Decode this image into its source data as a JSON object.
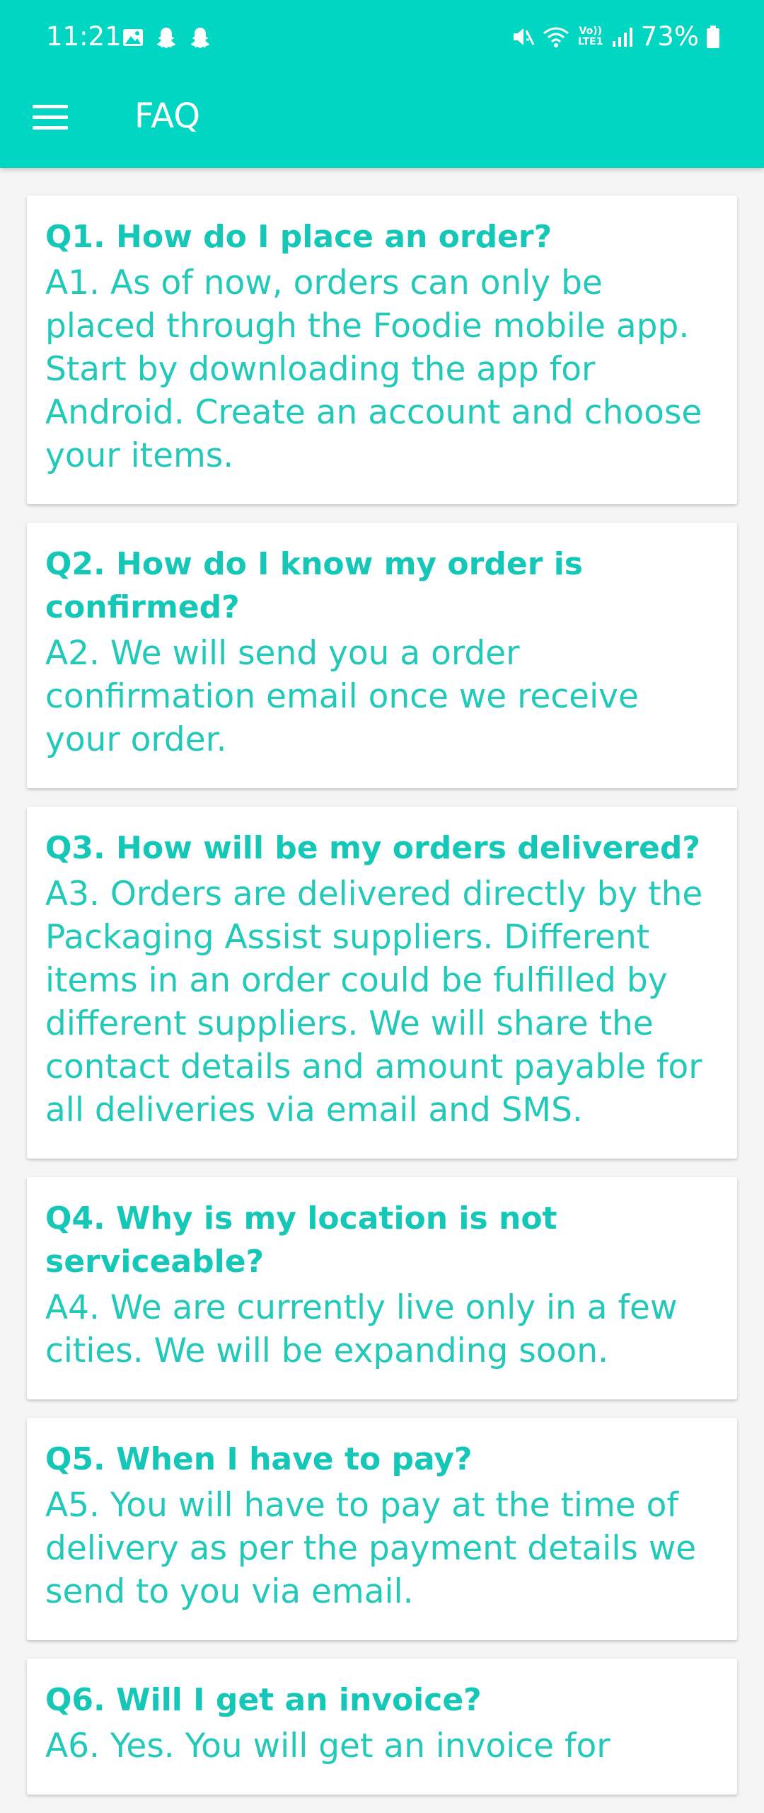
{
  "status_bar": {
    "time": "11:21",
    "battery": "73%",
    "left_icons": [
      "image-icon",
      "snapchat-icon",
      "snapchat-icon"
    ],
    "right_icons": [
      "mute-icon",
      "wifi-icon",
      "volte-icon",
      "signal-icon",
      "battery-icon"
    ],
    "volte_label": "Vo)) LTE1"
  },
  "toolbar": {
    "title": "FAQ",
    "menu_icon": "hamburger-menu-icon"
  },
  "colors": {
    "primary": "#00d6c1",
    "text_accent": "#14c7b6",
    "background": "#f5f5f5"
  },
  "faqs": [
    {
      "question": "Q1. How do I place an order?",
      "answer": "A1. As of now, orders can only be placed through the Foodie mobile app. Start by downloading the app for Android. Create an account and choose your items."
    },
    {
      "question": "Q2. How do I know my order is confirmed?",
      "answer": "A2. We will send you a order confirmation email once we receive your order."
    },
    {
      "question": "Q3. How will be my orders delivered?",
      "answer": "A3. Orders are delivered directly by the Packaging Assist suppliers. Different items in an order could be fulfilled by different suppliers. We will share the contact details and amount payable for all deliveries via email and SMS."
    },
    {
      "question": "Q4. Why is my location is not serviceable?",
      "answer": "A4. We are currently live only in a few cities. We will be expanding soon."
    },
    {
      "question": "Q5.  When I have to pay?",
      "answer": "A5. You will have to pay at the time of delivery as per the payment details we send to you via email."
    },
    {
      "question": "Q6. Will I get an invoice?",
      "answer": "A6. Yes. You will get an invoice for"
    }
  ]
}
